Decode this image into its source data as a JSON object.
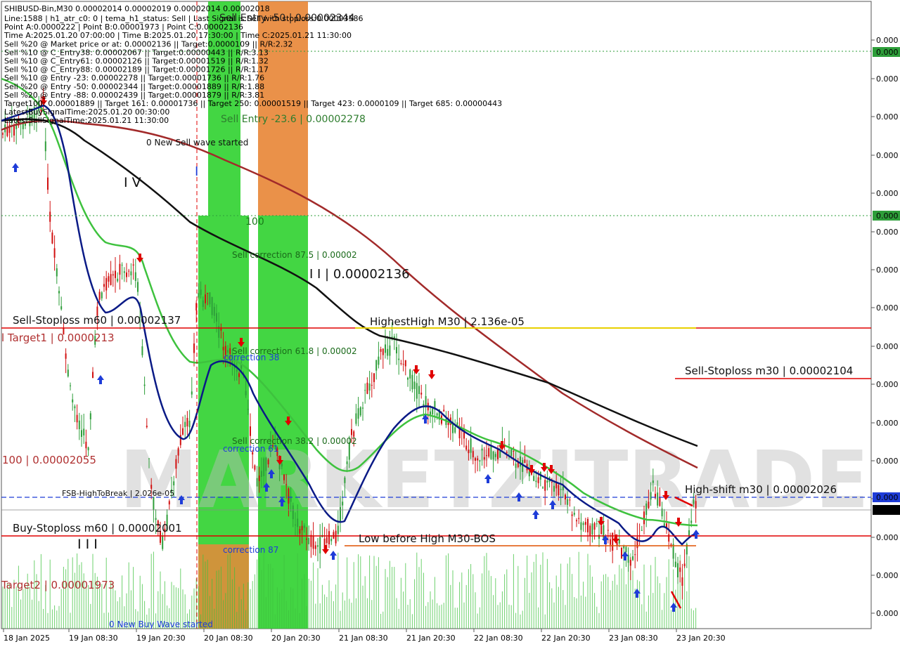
{
  "header": {
    "symbol_line": "SHIBUSD-Bin,M30  0.00002014 0.00002019 0.00002014 0.00002018",
    "overlay_line": "Sell Entry -50 | 0.00002344"
  },
  "info_lines": [
    "Line:1588 | h1_atr_c0: 0 | tema_h1_status: Sell | Last Signal is:Sell with stoploss:0.00003586",
    "Point A:0.0000222 | Point B:0.00001973 | Point C:0.00002136",
    "Time A:2025.01.20 07:00:00 | Time B:2025.01.20 17:30:00 | Time C:2025.01.21 11:30:00",
    "Sell %20 @ Market price or at: 0.00002136 || Target:0.0000109 || R/R:2.32",
    "Sell %10 @ C_Entry38: 0.00002067 || Target:0.00000443 || R/R:3.13",
    "Sell %10 @ C_Entry61: 0.00002126 || Target:0.00001519 || R/R:1.32",
    "Sell %10 @ C_Entry88: 0.00002189 || Target:0.00001726 || R/R:1.17",
    "Sell %10 @ Entry -23: 0.00002278 || Target:0.00001736 || R/R:1.76",
    "Sell %20 @ Entry -50: 0.00002344 || Target:0.00001889 || R/R:1.88",
    "Sell %20 @ Entry -88: 0.00002439 || Target:0.00001879 || R/R:3.81",
    "Target100: 0.00001889 || Target 161: 0.00001736 || Target 250: 0.00001519 || Target 423: 0.0000109 || Target 685: 0.00000443",
    "LatestBuySignalTime:2025.01.20 00:30:00",
    "LatestSellSignalTime:2025.01.21 11:30:00"
  ],
  "annotations": {
    "sell_entry_23": "Sell Entry -23.6 | 0.00002278",
    "new_sell_wave": "0 New Sell wave started",
    "new_buy_wave": "0 New Buy Wave started",
    "wave_iv": "I V",
    "wave_i": "I",
    "wave_ii": "I I | 0.00002136",
    "wave_iii": "I I I",
    "hundred_top": "100",
    "sell_corr_875": "Sell correction 87.5 | 0.00002",
    "sell_corr_618": "Sell correction 61.8 | 0.00002",
    "sell_corr_382": "Sell correction 38.2 | 0.00002",
    "corr_38": "correction 38",
    "corr_61": "correction 61",
    "corr_87": "correction 87",
    "highest_high": "HighestHigh   M30 | 2.136e-05",
    "sell_stoploss_m60": "Sell-Stoploss m60 | 0.00002137",
    "target1": "l Target1 | 0.0000213",
    "sell_stoploss_m30": "Sell-Stoploss m30 | 0.00002104",
    "hundred_left": "100 | 0.00002055",
    "high_shift": "High-shift m30 | 0.00002026",
    "fsb": "FSB-HighToBreak | 2.026e-05",
    "buy_stoploss_m60": "Buy-Stoploss m60 | 0.00002001",
    "low_before_high": "Low before High   M30-BOS",
    "target2": "Target2 | 0.00001973"
  },
  "watermark": "MARKETZITRADE",
  "price_axis": {
    "labels": [
      "0.000",
      "0.000",
      "0.000",
      "0.000",
      "0.000",
      "0.000",
      "0.000",
      "0.000",
      "0.000",
      "0.000",
      "0.000",
      "0.000",
      "0.000",
      "0.000",
      "0.000",
      "0.000"
    ],
    "badges": [
      {
        "text": "0.000",
        "color": "#2e9e3a"
      },
      {
        "text": "0.000",
        "color": "#2e9e3a"
      },
      {
        "text": "0.000",
        "color": "#1e3cd8"
      },
      {
        "text": "0.000",
        "color": "#000000"
      }
    ]
  },
  "time_axis": {
    "labels": [
      "18 Jan 2025",
      "19 Jan 08:30",
      "19 Jan 20:30",
      "20 Jan 08:30",
      "20 Jan 20:30",
      "21 Jan 08:30",
      "21 Jan 20:30",
      "22 Jan 08:30",
      "22 Jan 20:30",
      "23 Jan 08:30",
      "23 Jan 20:30"
    ]
  },
  "colors": {
    "bull": "#2e9e3a",
    "bear": "#d11010",
    "ma_navy": "#0a1a86",
    "ma_green": "#3ec23e",
    "ma_black": "#111111",
    "ma_brown": "#a22a2a",
    "level_red": "#e00000",
    "level_blue": "#1e3cd8",
    "zone_green": "#2fd12f",
    "zone_orange": "#e8883a"
  },
  "chart_data": {
    "type": "candlestick",
    "symbol": "SHIBUSD-Bin",
    "timeframe": "M30",
    "ohlc_last": {
      "open": 2.014e-05,
      "high": 2.019e-05,
      "low": 2.014e-05,
      "close": 2.018e-05
    },
    "levels": [
      {
        "name": "Sell-Stoploss m60",
        "value": 2.137e-05
      },
      {
        "name": "HighestHigh M30",
        "value": 2.136e-05
      },
      {
        "name": "Target1",
        "value": 2.13e-05
      },
      {
        "name": "Sell-Stoploss m30",
        "value": 2.104e-05
      },
      {
        "name": "100",
        "value": 2.055e-05
      },
      {
        "name": "High-shift m30",
        "value": 2.026e-05
      },
      {
        "name": "Buy-Stoploss m60",
        "value": 2.001e-05
      },
      {
        "name": "Target2",
        "value": 1.973e-05
      }
    ],
    "x_labels": [
      "18 Jan 2025",
      "19 Jan 08:30",
      "19 Jan 20:30",
      "20 Jan 08:30",
      "20 Jan 20:30",
      "21 Jan 08:30",
      "21 Jan 20:30",
      "22 Jan 08:30",
      "22 Jan 20:30",
      "23 Jan 08:30",
      "23 Jan 20:30"
    ]
  }
}
